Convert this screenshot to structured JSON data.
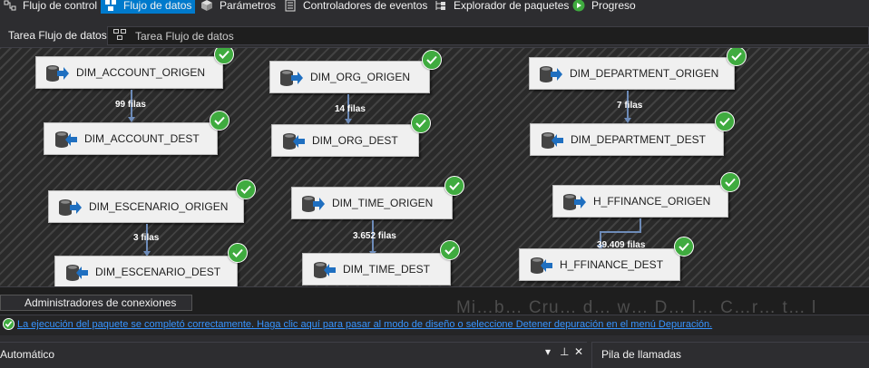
{
  "tabs": [
    {
      "id": "control",
      "label": "Flujo de control",
      "icon": "control-flow-icon"
    },
    {
      "id": "data",
      "label": "Flujo de datos",
      "icon": "data-flow-icon",
      "active": true
    },
    {
      "id": "params",
      "label": "Parámetros",
      "icon": "parameters-icon"
    },
    {
      "id": "events",
      "label": "Controladores de eventos",
      "icon": "event-handlers-icon"
    },
    {
      "id": "explorer",
      "label": "Explorador de paquetes",
      "icon": "package-explorer-icon"
    },
    {
      "id": "progress",
      "label": "Progreso",
      "icon": "play-icon"
    }
  ],
  "task": {
    "label": "Tarea Flujo de datos:",
    "selected": "Tarea Flujo de datos"
  },
  "components": [
    {
      "name": "DIM_ACCOUNT_ORIGEN",
      "kind": "source",
      "status": "success"
    },
    {
      "name": "DIM_ACCOUNT_DEST",
      "kind": "destination",
      "status": "success"
    },
    {
      "name": "DIM_ORG_ORIGEN",
      "kind": "source",
      "status": "success"
    },
    {
      "name": "DIM_ORG_DEST",
      "kind": "destination",
      "status": "success"
    },
    {
      "name": "DIM_DEPARTMENT_ORIGEN",
      "kind": "source",
      "status": "success"
    },
    {
      "name": "DIM_DEPARTMENT_DEST",
      "kind": "destination",
      "status": "success"
    },
    {
      "name": "DIM_ESCENARIO_ORIGEN",
      "kind": "source",
      "status": "success"
    },
    {
      "name": "DIM_ESCENARIO_DEST",
      "kind": "destination",
      "status": "success"
    },
    {
      "name": "DIM_TIME_ORIGEN",
      "kind": "source",
      "status": "success"
    },
    {
      "name": "DIM_TIME_DEST",
      "kind": "destination",
      "status": "success"
    },
    {
      "name": "H_FFINANCE_ORIGEN",
      "kind": "source",
      "status": "success"
    },
    {
      "name": "H_FFINANCE_DEST",
      "kind": "destination",
      "status": "success"
    }
  ],
  "flows": [
    {
      "rows": "99 filas"
    },
    {
      "rows": "14 filas"
    },
    {
      "rows": "7 filas"
    },
    {
      "rows": "3 filas"
    },
    {
      "rows": "3.652 filas"
    },
    {
      "rows": "39.409 filas"
    }
  ],
  "connection_managers": {
    "label": "Administradores de conexiones"
  },
  "ghost_text": "Mi…b… Cru… d… w… D… l… C…r… t… l",
  "status_message": "La ejecución del paquete se completó correctamente. Haga clic aquí para pasar al modo de diseño o seleccione Detener depuración en el menú Depuración.",
  "panes": {
    "left": {
      "title": "Automático",
      "pin": "▾ ⊕ ✕"
    },
    "right": {
      "title": "Pila de llamadas"
    }
  },
  "colors": {
    "accent": "#007acc",
    "success": "#3fab3f",
    "link": "#3794ff",
    "path": "#6d8bb8",
    "component_bg": "#f0f0f0"
  }
}
